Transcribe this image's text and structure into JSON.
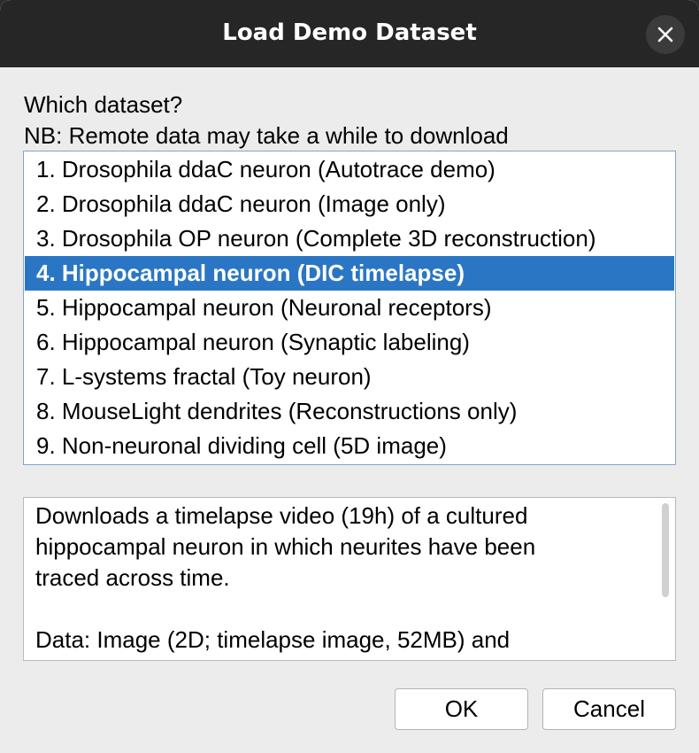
{
  "window": {
    "title": "Load Demo Dataset"
  },
  "prompt": {
    "line1": "Which dataset?",
    "line2": "NB: Remote data may take a while to download"
  },
  "datasets": {
    "selected_index": 3,
    "items": [
      "1. Drosophila ddaC neuron (Autotrace demo)",
      "2. Drosophila ddaC neuron (Image only)",
      "3. Drosophila OP neuron (Complete 3D reconstruction)",
      "4. Hippocampal neuron (DIC timelapse)",
      "5. Hippocampal neuron (Neuronal receptors)",
      "6. Hippocampal neuron (Synaptic labeling)",
      "7. L-systems fractal (Toy neuron)",
      "8. MouseLight dendrites (Reconstructions only)",
      "9. Non-neuronal dividing cell (5D image)"
    ]
  },
  "description": {
    "lines": [
      "Downloads a timelapse video (19h) of a cultured",
      "hippocampal neuron in which neurites have been",
      "traced across time.",
      "",
      "Data: Image (2D; timelapse image, 52MB) and"
    ]
  },
  "buttons": {
    "ok": "OK",
    "cancel": "Cancel"
  },
  "colors": {
    "selection": "#2a76c4",
    "titlebar": "#262626"
  },
  "icons": {
    "close": "close-icon"
  }
}
